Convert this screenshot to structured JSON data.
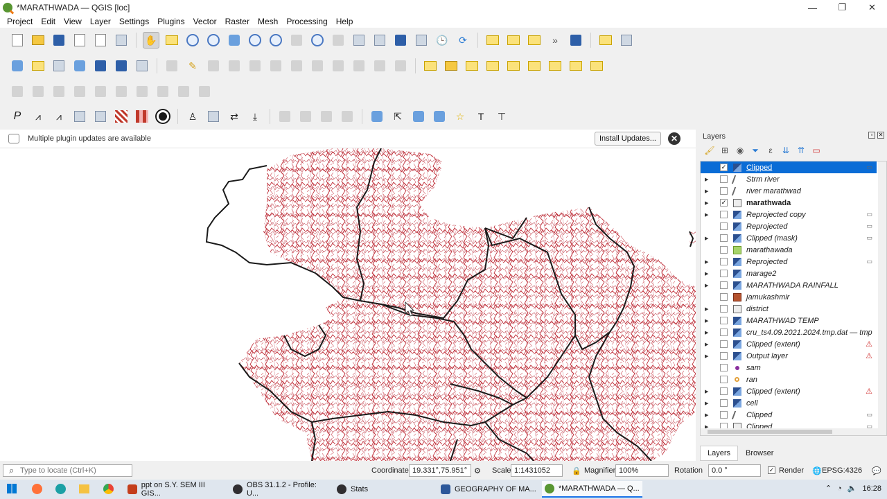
{
  "window": {
    "title": "*MARATHWADA — QGIS [loc]",
    "controls": [
      "—",
      "❐",
      "✕"
    ]
  },
  "menu": [
    "Project",
    "Edit",
    "View",
    "Layer",
    "Settings",
    "Plugins",
    "Vector",
    "Raster",
    "Mesh",
    "Processing",
    "Help"
  ],
  "notification": {
    "text": "Multiple plugin updates are available",
    "button": "Install Updates..."
  },
  "layers_panel": {
    "title": "Layers",
    "items": [
      {
        "name": "Clipped",
        "checked": true,
        "icon": "raster",
        "selected": true,
        "expander": false,
        "indicator": "embedded"
      },
      {
        "name": "Strm river",
        "checked": false,
        "icon": "line",
        "expander": true
      },
      {
        "name": "river marathwad",
        "checked": false,
        "icon": "line",
        "expander": true
      },
      {
        "name": "marathwada",
        "checked": true,
        "icon": "polygon",
        "expander": true,
        "bold": true
      },
      {
        "name": "Reprojected copy",
        "checked": false,
        "icon": "raster",
        "expander": true,
        "indicator": "embedded"
      },
      {
        "name": "Reprojected",
        "checked": false,
        "icon": "raster",
        "expander": false,
        "indicator": "embedded"
      },
      {
        "name": "Clipped (mask)",
        "checked": false,
        "icon": "raster",
        "expander": true,
        "indicator": "embedded"
      },
      {
        "name": "marathawada",
        "checked": false,
        "icon": "green",
        "expander": false
      },
      {
        "name": "Reprojected",
        "checked": false,
        "icon": "raster",
        "expander": true,
        "indicator": "embedded"
      },
      {
        "name": "marage2",
        "checked": false,
        "icon": "raster",
        "expander": true
      },
      {
        "name": "MARATHWADA RAINFALL",
        "checked": false,
        "icon": "raster",
        "expander": true
      },
      {
        "name": "jamukashmir",
        "checked": false,
        "icon": "brown",
        "expander": false
      },
      {
        "name": "district",
        "checked": false,
        "icon": "polygon",
        "expander": true
      },
      {
        "name": "MARATHWAD TEMP",
        "checked": false,
        "icon": "raster",
        "expander": true
      },
      {
        "name": "cru_ts4.09.2021.2024.tmp.dat — tmp",
        "checked": false,
        "icon": "raster",
        "expander": true
      },
      {
        "name": "Clipped (extent)",
        "checked": false,
        "icon": "raster",
        "expander": true,
        "indicator": "warning"
      },
      {
        "name": "Output layer",
        "checked": false,
        "icon": "raster",
        "expander": true,
        "indicator": "warning"
      },
      {
        "name": "sam",
        "checked": false,
        "icon": "purple",
        "expander": false
      },
      {
        "name": "ran",
        "checked": false,
        "icon": "orange",
        "expander": false
      },
      {
        "name": "Clipped (extent)",
        "checked": false,
        "icon": "raster",
        "expander": true,
        "indicator": "warning"
      },
      {
        "name": "cell",
        "checked": false,
        "icon": "raster",
        "expander": true
      },
      {
        "name": "Clipped",
        "checked": false,
        "icon": "line",
        "expander": true,
        "indicator": "embedded"
      },
      {
        "name": "Clipped",
        "checked": false,
        "icon": "polygon",
        "expander": true,
        "indicator": "embedded"
      }
    ],
    "tabs": [
      "Layers",
      "Browser"
    ]
  },
  "statusbar": {
    "locator_placeholder": "Type to locate (Ctrl+K)",
    "coordinate_label": "Coordinate",
    "coordinate_value": "19.331°,75.951°",
    "scale_label": "Scale",
    "scale_value": "1:1431052",
    "magnifier_label": "Magnifier",
    "magnifier_value": "100%",
    "rotation_label": "Rotation",
    "rotation_value": "0.0 °",
    "render_label": "Render",
    "crs": "EPSG:4326"
  },
  "taskbar": {
    "tasks": [
      {
        "label": "ppt on S.Y. SEM III GIS...",
        "color": "#c43e1c"
      },
      {
        "label": "OBS 31.1.2 - Profile: U...",
        "color": "#302e31"
      },
      {
        "label": "Stats",
        "color": "#302e31"
      },
      {
        "label": "GEOGRAPHY OF MA...",
        "color": "#2b579a"
      },
      {
        "label": "*MARATHWADA — Q...",
        "color": "#589632",
        "active": true
      }
    ],
    "time": "16:28"
  },
  "colors": {
    "map_stream": "#c0303a",
    "map_boundary": "#1a1a1a",
    "selection": "#0a6cd6",
    "qgis_green": "#589632"
  }
}
